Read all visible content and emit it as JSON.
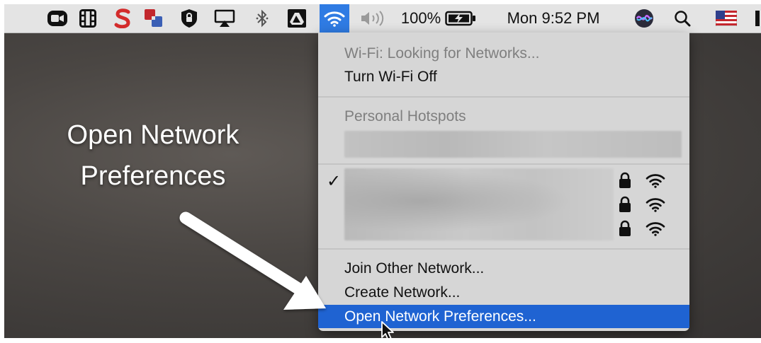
{
  "menubar": {
    "volume_icon": "speaker-icon",
    "battery_percent": "100%",
    "clock": "Mon 9:52 PM",
    "icons": [
      "zoom-icon",
      "film-icon",
      "s-app-icon",
      "parallels-icon",
      "shield-icon",
      "airplay-icon",
      "bluetooth-icon",
      "google-drive-icon",
      "wifi-icon",
      "speaker-icon",
      "battery-icon",
      "siri-icon",
      "search-icon",
      "flag-icon"
    ]
  },
  "wifi_menu": {
    "status": "Wi-Fi: Looking for Networks...",
    "toggle": "Turn Wi-Fi Off",
    "hotspots_header": "Personal Hotspots",
    "checkmark": "✓",
    "join_other": "Join Other Network...",
    "create_network": "Create Network...",
    "open_prefs": "Open Network Preferences..."
  },
  "callout": {
    "line1": "Open Network",
    "line2": "Preferences"
  },
  "colors": {
    "menubar_bg": "#e4e4e4",
    "menu_bg": "#d6d6d6",
    "selection": "#1f63d2",
    "wifi_highlight": "#2f7be3"
  }
}
